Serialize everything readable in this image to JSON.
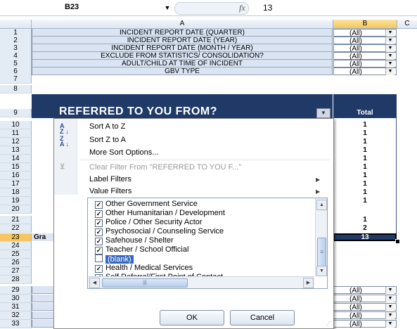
{
  "formula_bar": {
    "name_box": "B23",
    "fx": "fx",
    "value": "13"
  },
  "columns": [
    "A",
    "B",
    "C"
  ],
  "filter_rows": [
    {
      "row": "1",
      "label": "INCIDENT REPORT DATE (QUARTER)",
      "value": "(All)"
    },
    {
      "row": "2",
      "label": "INCIDENT REPORT DATE (YEAR)",
      "value": "(All)"
    },
    {
      "row": "3",
      "label": "INCIDENT REPORT DATE (MONTH / YEAR)",
      "value": "(All)"
    },
    {
      "row": "4",
      "label": "EXCLUDE FROM STATISTICS/ CONSOLIDATION?",
      "value": "(All)"
    },
    {
      "row": "5",
      "label": "ADULT/CHILD AT TIME OF INCIDENT",
      "value": "(All)"
    },
    {
      "row": "6",
      "label": "GBV TYPE",
      "value": "(All)"
    }
  ],
  "row_numbers": [
    "7",
    "8",
    "9",
    "10",
    "11",
    "12",
    "13",
    "14",
    "15",
    "16",
    "17",
    "18",
    "19",
    "20",
    "21",
    "22",
    "23",
    "24",
    "25",
    "26",
    "27",
    "28",
    "29",
    "30",
    "31",
    "32",
    "33"
  ],
  "pivot": {
    "title": "REFERRED TO YOU FROM?",
    "total_header": "Total",
    "totals": [
      "1",
      "1",
      "1",
      "1",
      "1",
      "1",
      "1",
      "1",
      "1",
      "1",
      "",
      "1",
      "2",
      "13"
    ],
    "grand_label": "Gra",
    "bottom_values": [
      "(All)",
      "(All)",
      "(All)",
      "(All)",
      "(All)"
    ]
  },
  "menu": {
    "sort_az": "Sort A to Z",
    "sort_za": "Sort Z to A",
    "more_sort": "More Sort Options...",
    "clear_filter": "Clear Filter From \"REFERRED TO YOU F...\"",
    "label_filters": "Label Filters",
    "value_filters": "Value Filters"
  },
  "list_items": [
    {
      "label": "Other Government Service",
      "checked": true
    },
    {
      "label": "Other Humanitarian / Development",
      "checked": true
    },
    {
      "label": "Police / Other Security Actor",
      "checked": true
    },
    {
      "label": "Psychosocial / Counseling Service",
      "checked": true
    },
    {
      "label": "Safehouse / Shelter",
      "checked": true
    },
    {
      "label": "Teacher / School Official",
      "checked": true
    },
    {
      "label": "(blank)",
      "checked": false
    },
    {
      "label": "Health / Medical Services",
      "checked": true
    },
    {
      "label": "Self Referral/First Point of Contact",
      "checked": true
    }
  ],
  "buttons": {
    "ok": "OK",
    "cancel": "Cancel"
  }
}
